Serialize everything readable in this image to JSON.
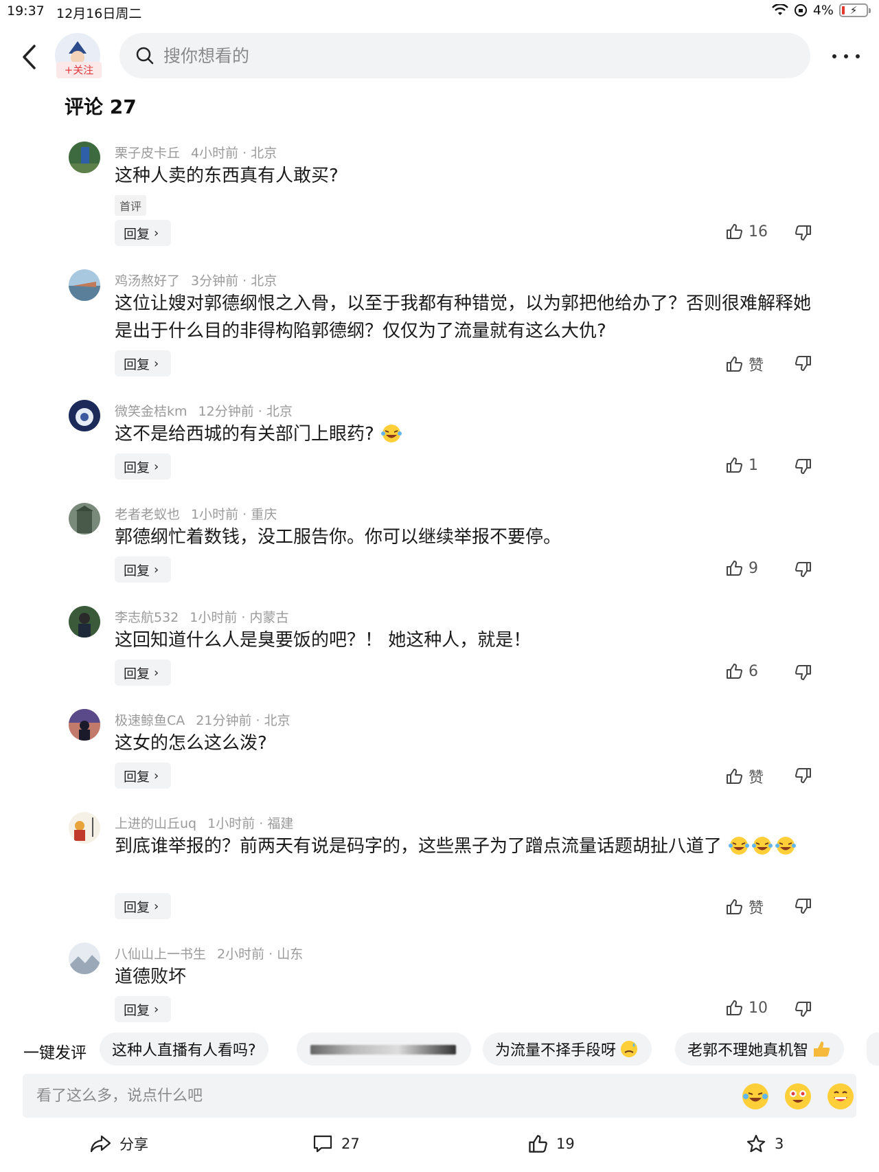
{
  "status_bar": {
    "time": "19:37",
    "date": "12月16日周二",
    "battery": "4%"
  },
  "header": {
    "follow_label": "+关注",
    "search_placeholder": "搜你想看的"
  },
  "comments_header": {
    "title": "评论 27"
  },
  "comments": [
    {
      "name": "栗子皮卡丘",
      "time": "4小时前",
      "location": "北京",
      "text": "这种人卖的东西真有人敢买?",
      "tag": "首评",
      "reply": "回复",
      "likes": "16"
    },
    {
      "name": "鸡汤熬好了",
      "time": "3分钟前",
      "location": "北京",
      "text": "这位让嫂对郭德纲恨之入骨，以至于我都有种错觉，以为郭把他给办了？否则很难解释她是出于什么目的非得构陷郭德纲？仅仅为了流量就有这么大仇?",
      "reply": "回复",
      "likes": "赞"
    },
    {
      "name": "微笑金桔km",
      "time": "12分钟前",
      "location": "北京",
      "text": "这不是给西城的有关部门上眼药?",
      "reply": "回复",
      "likes": "1"
    },
    {
      "name": "老者老蚁也",
      "time": "1小时前",
      "location": "重庆",
      "text": "郭德纲忙着数钱，没工服告你。你可以继续举报不要停。",
      "reply": "回复",
      "likes": "9"
    },
    {
      "name": "李志航532",
      "time": "1小时前",
      "location": "内蒙古",
      "text": "这回知道什么人是臭要饭的吧？！ 她这种人，就是！",
      "reply": "回复",
      "likes": "6"
    },
    {
      "name": "极速鲸鱼CA",
      "time": "21分钟前",
      "location": "北京",
      "text": "这女的怎么这么泼?",
      "reply": "回复",
      "likes": "赞"
    },
    {
      "name": "上进的山丘uq",
      "time": "1小时前",
      "location": "福建",
      "text": "到底谁举报的？前两天有说是码字的，这些黑子为了蹭点流量话题胡扯八道了",
      "reply": "回复",
      "likes": "赞"
    },
    {
      "name": "八仙山上一书生",
      "time": "2小时前",
      "location": "山东",
      "text": "道德败坏",
      "reply": "回复",
      "likes": "10"
    }
  ],
  "quick_comments": {
    "label": "一键发评",
    "chips": [
      "这种人直播有人看吗?",
      "",
      "为流量不择手段呀",
      "老郭不理她真机智"
    ]
  },
  "input": {
    "placeholder": "看了这么多，说点什么吧"
  },
  "bottom_bar": {
    "share": "分享",
    "comments": "27",
    "likes": "19",
    "favorites": "3"
  },
  "colors": {
    "accent_red": "#e03a3e",
    "meta_gray": "#9a9a9a",
    "chip_bg": "#f2f3f5"
  },
  "icons": [
    "back-arrow-icon",
    "search-icon",
    "more-icon",
    "thumbs-up-icon",
    "thumbs-down-icon",
    "share-icon",
    "comment-icon",
    "star-icon",
    "laughing-emoji-icon"
  ]
}
